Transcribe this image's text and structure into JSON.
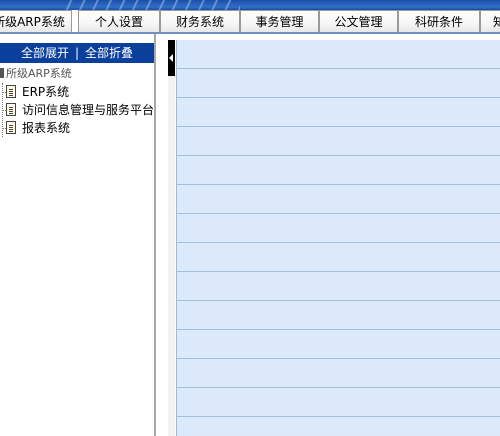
{
  "nav": {
    "tabs": [
      {
        "label": "所级ARP系统"
      },
      {
        "label": "个人设置"
      },
      {
        "label": "财务系统"
      },
      {
        "label": "事务管理"
      },
      {
        "label": "公文管理"
      },
      {
        "label": "科研条件"
      },
      {
        "label": "知"
      }
    ]
  },
  "sidebar": {
    "expand_all": "全部展开",
    "separator": "|",
    "collapse_all": "全部折叠",
    "root_label": "所级ARP系统",
    "items": [
      {
        "label": "ERP系统"
      },
      {
        "label": "访问信息管理与服务平台"
      },
      {
        "label": "报表系统"
      }
    ]
  },
  "colors": {
    "header_bg": "#0a3f9c",
    "content_bg": "#dce9fb",
    "content_lines": "#9fc1df"
  }
}
